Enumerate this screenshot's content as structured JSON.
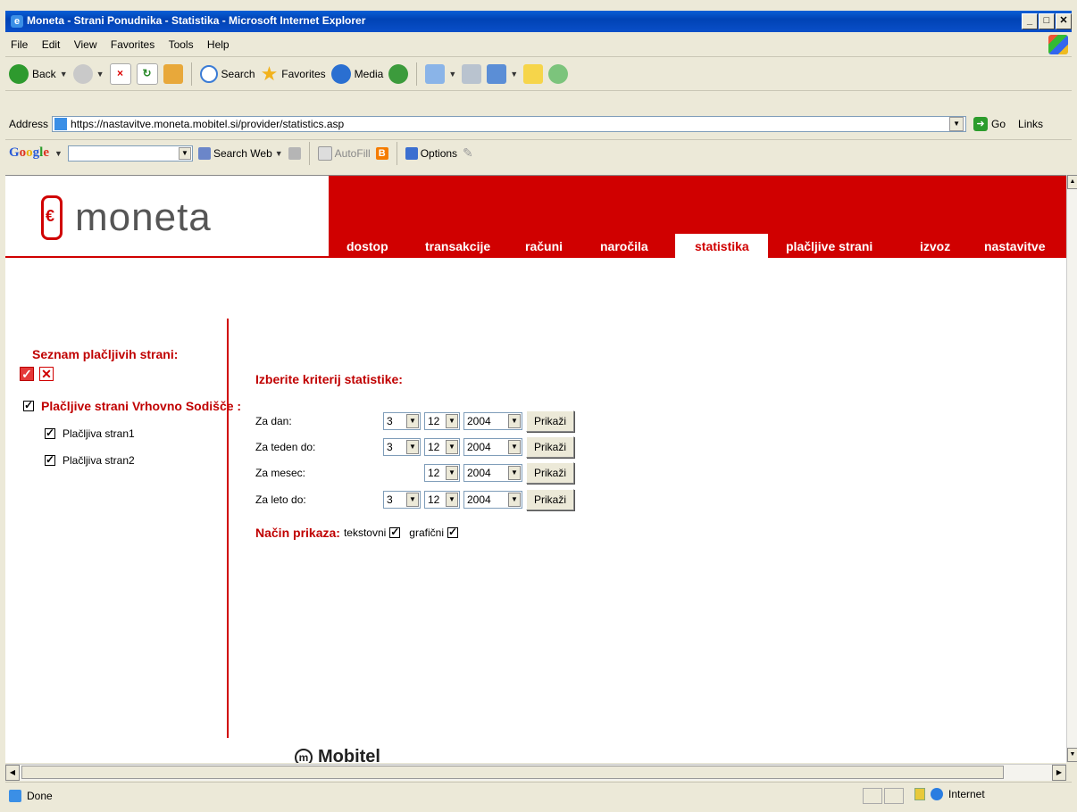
{
  "window": {
    "title": "Moneta - Strani Ponudnika - Statistika - Microsoft Internet Explorer"
  },
  "menu": [
    "File",
    "Edit",
    "View",
    "Favorites",
    "Tools",
    "Help"
  ],
  "toolbar": {
    "back": "Back",
    "search": "Search",
    "favorites": "Favorites",
    "media": "Media"
  },
  "address": {
    "label": "Address",
    "url": "https://nastavitve.moneta.mobitel.si/provider/statistics.asp",
    "go": "Go",
    "links": "Links"
  },
  "googlebar": {
    "logo": "Google",
    "search_web": "Search Web",
    "autofill": "AutoFill",
    "options": "Options"
  },
  "page": {
    "logo_text": "moneta",
    "nav": [
      {
        "label": "dostop"
      },
      {
        "label": "transakcije"
      },
      {
        "label": "računi"
      },
      {
        "label": "naročila"
      },
      {
        "label": "statistika"
      },
      {
        "label": "plačljive strani"
      },
      {
        "label": "izvoz"
      },
      {
        "label": "nastavitve"
      }
    ],
    "sidebar": {
      "title": "Seznam plačljivih strani:",
      "group_label": "Plačljive strani Vrhovno Sodišče :",
      "items": [
        "Plačljiva stran1",
        "Plačljiva stran2"
      ]
    },
    "form": {
      "heading": "Izberite kriterij statistike:",
      "rows": [
        {
          "label": "Za dan:",
          "day": "3",
          "month": "12",
          "year": "2004",
          "button": "Prikaži"
        },
        {
          "label": "Za teden do:",
          "day": "3",
          "month": "12",
          "year": "2004",
          "button": "Prikaži"
        },
        {
          "label": "Za mesec:",
          "day": "",
          "month": "12",
          "year": "2004",
          "button": "Prikaži"
        },
        {
          "label": "Za leto do:",
          "day": "3",
          "month": "12",
          "year": "2004",
          "button": "Prikaži"
        }
      ],
      "display_mode_label": "Način prikaza:",
      "text_option": "tekstovni",
      "graph_option": "grafični"
    },
    "footer_logo": "Mobitel"
  },
  "status": {
    "text": "Done",
    "zone": "Internet"
  },
  "colors": {
    "brand_red": "#d00000",
    "xp_blue": "#0a5fd6"
  }
}
